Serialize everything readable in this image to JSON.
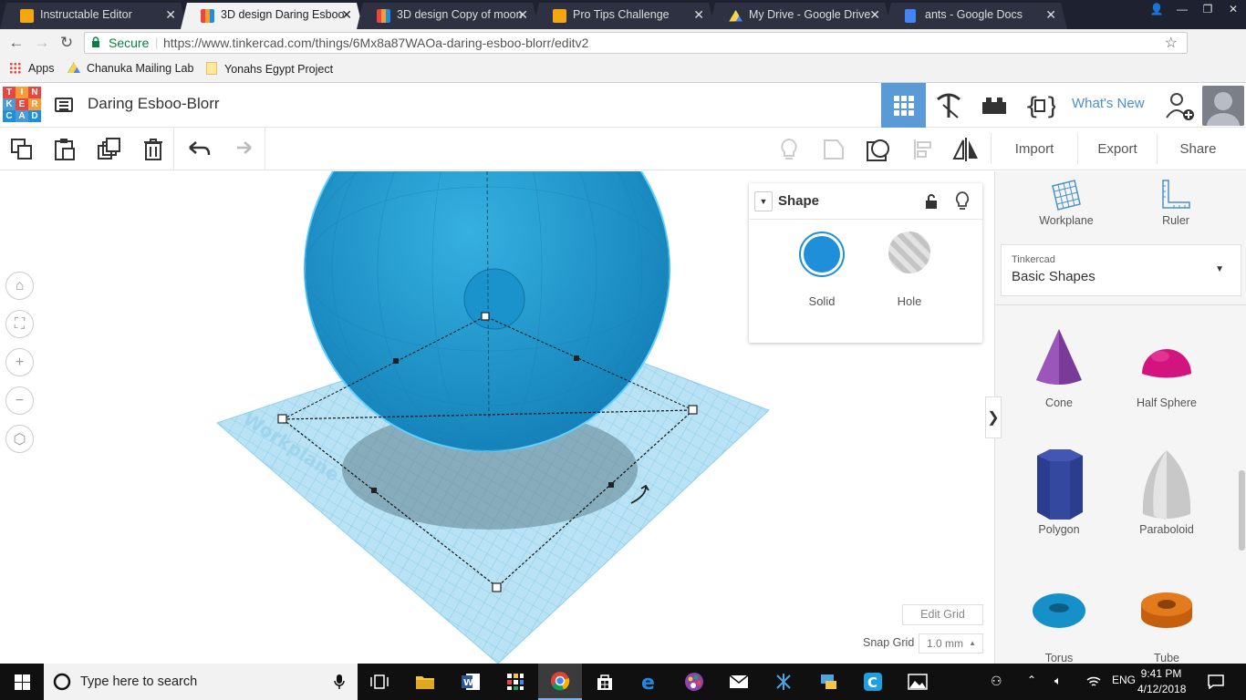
{
  "browser": {
    "tabs": [
      {
        "label": "Instructable Editor",
        "icon": "instructables-favicon",
        "color": "#f4a70e",
        "active": false
      },
      {
        "label": "3D design Daring Esboo-",
        "icon": "tinkercad-favicon",
        "color": "#e8463e",
        "active": true
      },
      {
        "label": "3D design Copy of moon",
        "icon": "tinkercad-favicon",
        "color": "#e8463e",
        "active": false
      },
      {
        "label": "Pro Tips Challenge",
        "icon": "instructables-favicon",
        "color": "#f4a70e",
        "active": false
      },
      {
        "label": "My Drive - Google Drive",
        "icon": "drive-favicon",
        "color": "#1fa463",
        "active": false
      },
      {
        "label": "ants - Google Docs",
        "icon": "docs-favicon",
        "color": "#4285f4",
        "active": false
      }
    ],
    "secure_label": "Secure",
    "url": "https://www.tinkercad.com/things/6Mx8a87WAOa-daring-esboo-blorr/editv2",
    "extension_badge": "1",
    "bookmarks": [
      "Apps",
      "Chanuka Mailing Lab",
      "Yonahs Egypt Project"
    ]
  },
  "app": {
    "logo_letters": [
      "T",
      "I",
      "N",
      "K",
      "E",
      "R",
      "C",
      "A",
      "D"
    ],
    "logo_colors": [
      "#e8463e",
      "#f29d35",
      "#e8463e",
      "#4a9bd8",
      "#e8463e",
      "#f29d35",
      "#1e8fd8",
      "#4a9bd8",
      "#1e8fd8"
    ],
    "design_title": "Daring Esboo-Blorr",
    "whats_new": "What's New"
  },
  "toolbar": {
    "import": "Import",
    "export": "Export",
    "share": "Share"
  },
  "shape_panel": {
    "title": "Shape",
    "solid_label": "Solid",
    "hole_label": "Hole",
    "solid_color": "#1e8fd8"
  },
  "workplane": {
    "label": "Workplane",
    "edit_grid": "Edit Grid",
    "snap_grid_label": "Snap Grid",
    "snap_grid_value": "1.0 mm"
  },
  "right_panel": {
    "tools": [
      "Workplane",
      "Ruler"
    ],
    "library_source": "Tinkercad",
    "library_name": "Basic Shapes",
    "shapes": [
      {
        "name": "Cone",
        "icon": "cone-icon",
        "color": "#7a3a9a"
      },
      {
        "name": "Half Sphere",
        "icon": "half-sphere-icon",
        "color": "#d4147e"
      },
      {
        "name": "Polygon",
        "icon": "polygon-icon",
        "color": "#2a3d8e"
      },
      {
        "name": "Paraboloid",
        "icon": "paraboloid-icon",
        "color": "#c8c8c8"
      },
      {
        "name": "Torus",
        "icon": "torus-icon",
        "color": "#1690c8"
      },
      {
        "name": "Tube",
        "icon": "tube-icon",
        "color": "#e37a1c"
      }
    ]
  },
  "taskbar": {
    "search_placeholder": "Type here to search",
    "language": "ENG",
    "time": "9:41 PM",
    "date": "4/12/2018"
  }
}
